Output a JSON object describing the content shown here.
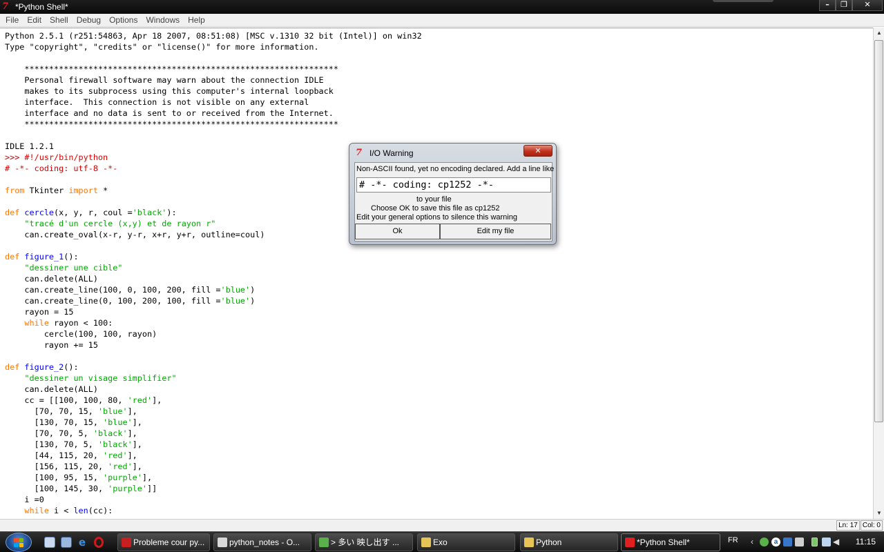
{
  "window": {
    "title": "*Python Shell*",
    "app_icon": "tk-feather-icon",
    "buttons": [
      "minimize",
      "maximize",
      "close"
    ]
  },
  "menu": [
    "File",
    "Edit",
    "Shell",
    "Debug",
    "Options",
    "Windows",
    "Help"
  ],
  "shell": {
    "lines": [
      [
        {
          "t": "Python 2.5.1 (r251:54863, Apr 18 2007, 08:51:08) [MSC v.1310 32 bit (Intel)] on win32",
          "c": ""
        }
      ],
      [
        {
          "t": "Type \"copyright\", \"credits\" or \"license()\" for more information.",
          "c": ""
        }
      ],
      [
        {
          "t": "",
          "c": ""
        }
      ],
      [
        {
          "t": "    ****************************************************************",
          "c": ""
        }
      ],
      [
        {
          "t": "    Personal firewall software may warn about the connection IDLE",
          "c": ""
        }
      ],
      [
        {
          "t": "    makes to its subprocess using this computer's internal loopback",
          "c": ""
        }
      ],
      [
        {
          "t": "    interface.  This connection is not visible on any external",
          "c": ""
        }
      ],
      [
        {
          "t": "    interface and no data is sent to or received from the Internet.",
          "c": ""
        }
      ],
      [
        {
          "t": "    ****************************************************************",
          "c": ""
        }
      ],
      [
        {
          "t": "",
          "c": ""
        }
      ],
      [
        {
          "t": "IDLE 1.2.1",
          "c": ""
        }
      ],
      [
        {
          "t": ">>> ",
          "c": "prompt"
        },
        {
          "t": "#!/usr/bin/python",
          "c": "com"
        }
      ],
      [
        {
          "t": "# -*- coding: utf-8 -*-",
          "c": "com"
        }
      ],
      [
        {
          "t": "",
          "c": ""
        }
      ],
      [
        {
          "t": "from",
          "c": "kw"
        },
        {
          "t": " Tkinter ",
          "c": ""
        },
        {
          "t": "import",
          "c": "kw"
        },
        {
          "t": " *",
          "c": ""
        }
      ],
      [
        {
          "t": "",
          "c": ""
        }
      ],
      [
        {
          "t": "def",
          "c": "kw"
        },
        {
          "t": " ",
          "c": ""
        },
        {
          "t": "cercle",
          "c": "def"
        },
        {
          "t": "(x, y, r, coul =",
          "c": ""
        },
        {
          "t": "'black'",
          "c": "str"
        },
        {
          "t": "):",
          "c": ""
        }
      ],
      [
        {
          "t": "    ",
          "c": ""
        },
        {
          "t": "\"tracé d'un cercle (x,y) et de rayon r\"",
          "c": "str"
        }
      ],
      [
        {
          "t": "    can.create_oval(x-r, y-r, x+r, y+r, outline=coul)",
          "c": ""
        }
      ],
      [
        {
          "t": "",
          "c": ""
        }
      ],
      [
        {
          "t": "def",
          "c": "kw"
        },
        {
          "t": " ",
          "c": ""
        },
        {
          "t": "figure_1",
          "c": "def"
        },
        {
          "t": "():",
          "c": ""
        }
      ],
      [
        {
          "t": "    ",
          "c": ""
        },
        {
          "t": "\"dessiner une cible\"",
          "c": "str"
        }
      ],
      [
        {
          "t": "    can.delete(ALL)",
          "c": ""
        }
      ],
      [
        {
          "t": "    can.create_line(100, 0, 100, 200, fill =",
          "c": ""
        },
        {
          "t": "'blue'",
          "c": "str"
        },
        {
          "t": ")",
          "c": ""
        }
      ],
      [
        {
          "t": "    can.create_line(0, 100, 200, 100, fill =",
          "c": ""
        },
        {
          "t": "'blue'",
          "c": "str"
        },
        {
          "t": ")",
          "c": ""
        }
      ],
      [
        {
          "t": "    rayon = 15",
          "c": ""
        }
      ],
      [
        {
          "t": "    ",
          "c": ""
        },
        {
          "t": "while",
          "c": "kw"
        },
        {
          "t": " rayon < 100:",
          "c": ""
        }
      ],
      [
        {
          "t": "        cercle(100, 100, rayon)",
          "c": ""
        }
      ],
      [
        {
          "t": "        rayon += 15",
          "c": ""
        }
      ],
      [
        {
          "t": "",
          "c": ""
        }
      ],
      [
        {
          "t": "def",
          "c": "kw"
        },
        {
          "t": " ",
          "c": ""
        },
        {
          "t": "figure_2",
          "c": "def"
        },
        {
          "t": "():",
          "c": ""
        }
      ],
      [
        {
          "t": "    ",
          "c": ""
        },
        {
          "t": "\"dessiner un visage simplifier\"",
          "c": "str"
        }
      ],
      [
        {
          "t": "    can.delete(ALL)",
          "c": ""
        }
      ],
      [
        {
          "t": "    cc = [[100, 100, 80, ",
          "c": ""
        },
        {
          "t": "'red'",
          "c": "str"
        },
        {
          "t": "],",
          "c": ""
        }
      ],
      [
        {
          "t": "      [70, 70, 15, ",
          "c": ""
        },
        {
          "t": "'blue'",
          "c": "str"
        },
        {
          "t": "],",
          "c": ""
        }
      ],
      [
        {
          "t": "      [130, 70, 15, ",
          "c": ""
        },
        {
          "t": "'blue'",
          "c": "str"
        },
        {
          "t": "],",
          "c": ""
        }
      ],
      [
        {
          "t": "      [70, 70, 5, ",
          "c": ""
        },
        {
          "t": "'black'",
          "c": "str"
        },
        {
          "t": "],",
          "c": ""
        }
      ],
      [
        {
          "t": "      [130, 70, 5, ",
          "c": ""
        },
        {
          "t": "'black'",
          "c": "str"
        },
        {
          "t": "],",
          "c": ""
        }
      ],
      [
        {
          "t": "      [44, 115, 20, ",
          "c": ""
        },
        {
          "t": "'red'",
          "c": "str"
        },
        {
          "t": "],",
          "c": ""
        }
      ],
      [
        {
          "t": "      [156, 115, 20, ",
          "c": ""
        },
        {
          "t": "'red'",
          "c": "str"
        },
        {
          "t": "],",
          "c": ""
        }
      ],
      [
        {
          "t": "      [100, 95, 15, ",
          "c": ""
        },
        {
          "t": "'purple'",
          "c": "str"
        },
        {
          "t": "],",
          "c": ""
        }
      ],
      [
        {
          "t": "      [100, 145, 30, ",
          "c": ""
        },
        {
          "t": "'purple'",
          "c": "str"
        },
        {
          "t": "]]",
          "c": ""
        }
      ],
      [
        {
          "t": "    i =0",
          "c": ""
        }
      ],
      [
        {
          "t": "    ",
          "c": ""
        },
        {
          "t": "while",
          "c": "kw"
        },
        {
          "t": " i < ",
          "c": ""
        },
        {
          "t": "len",
          "c": "def"
        },
        {
          "t": "(cc):",
          "c": ""
        }
      ]
    ]
  },
  "status": {
    "line": "Ln: 17",
    "col": "Col: 0"
  },
  "dialog": {
    "title": "I/O Warning",
    "close_icon": "close-icon",
    "message_1": "Non-ASCII found, yet no encoding declared. Add a line like",
    "entry_value": "# -*- coding: cp1252 -*-",
    "message_2": "to your file",
    "message_3": "Choose OK to save this file as cp1252",
    "message_4": "Edit your general options to silence this warning",
    "ok_label": "Ok",
    "edit_label": "Edit my file"
  },
  "taskbar": {
    "quick_launch": [
      "show-desktop-icon",
      "switch-windows-icon",
      "internet-explorer-icon",
      "opera-icon"
    ],
    "tasks": [
      {
        "label": "Probleme cour py...",
        "icon": "opera-icon",
        "color": "#c82020"
      },
      {
        "label": "python_notes - O...",
        "icon": "document-icon",
        "color": "#d8d8d8"
      },
      {
        "label": "> 多い 映し出す ...",
        "icon": "messenger-icon",
        "color": "#5ab04a"
      },
      {
        "label": "Exo",
        "icon": "folder-icon",
        "color": "#e8c456"
      },
      {
        "label": "Python",
        "icon": "folder-icon",
        "color": "#e8c456"
      },
      {
        "label": "*Python Shell*",
        "icon": "tk-feather-icon",
        "color": "#e02020",
        "active": true
      }
    ],
    "language": "FR",
    "clock": "11:15",
    "tray_icons": [
      "chevron-left-icon",
      "messenger-tray-icon",
      "avast-icon",
      "network-activity-icon",
      "keyboard-icon",
      "battery-icon",
      "network-icon",
      "volume-icon"
    ]
  },
  "colors": {
    "keyword": "#ff7700",
    "defname": "#0000ff",
    "string": "#00aa00",
    "comment": "#dd0000"
  }
}
